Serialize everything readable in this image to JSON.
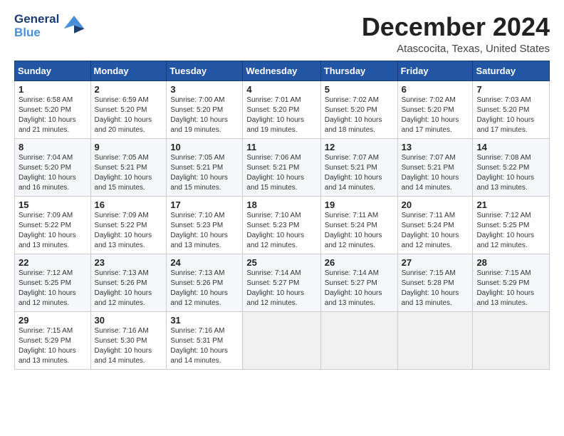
{
  "logo": {
    "line1": "General",
    "line2": "Blue"
  },
  "header": {
    "month": "December 2024",
    "location": "Atascocita, Texas, United States"
  },
  "days_of_week": [
    "Sunday",
    "Monday",
    "Tuesday",
    "Wednesday",
    "Thursday",
    "Friday",
    "Saturday"
  ],
  "weeks": [
    [
      {
        "day": 1,
        "sunrise": "6:58 AM",
        "sunset": "5:20 PM",
        "daylight": "10 hours and 21 minutes."
      },
      {
        "day": 2,
        "sunrise": "6:59 AM",
        "sunset": "5:20 PM",
        "daylight": "10 hours and 20 minutes."
      },
      {
        "day": 3,
        "sunrise": "7:00 AM",
        "sunset": "5:20 PM",
        "daylight": "10 hours and 19 minutes."
      },
      {
        "day": 4,
        "sunrise": "7:01 AM",
        "sunset": "5:20 PM",
        "daylight": "10 hours and 19 minutes."
      },
      {
        "day": 5,
        "sunrise": "7:02 AM",
        "sunset": "5:20 PM",
        "daylight": "10 hours and 18 minutes."
      },
      {
        "day": 6,
        "sunrise": "7:02 AM",
        "sunset": "5:20 PM",
        "daylight": "10 hours and 17 minutes."
      },
      {
        "day": 7,
        "sunrise": "7:03 AM",
        "sunset": "5:20 PM",
        "daylight": "10 hours and 17 minutes."
      }
    ],
    [
      {
        "day": 8,
        "sunrise": "7:04 AM",
        "sunset": "5:20 PM",
        "daylight": "10 hours and 16 minutes."
      },
      {
        "day": 9,
        "sunrise": "7:05 AM",
        "sunset": "5:21 PM",
        "daylight": "10 hours and 15 minutes."
      },
      {
        "day": 10,
        "sunrise": "7:05 AM",
        "sunset": "5:21 PM",
        "daylight": "10 hours and 15 minutes."
      },
      {
        "day": 11,
        "sunrise": "7:06 AM",
        "sunset": "5:21 PM",
        "daylight": "10 hours and 15 minutes."
      },
      {
        "day": 12,
        "sunrise": "7:07 AM",
        "sunset": "5:21 PM",
        "daylight": "10 hours and 14 minutes."
      },
      {
        "day": 13,
        "sunrise": "7:07 AM",
        "sunset": "5:21 PM",
        "daylight": "10 hours and 14 minutes."
      },
      {
        "day": 14,
        "sunrise": "7:08 AM",
        "sunset": "5:22 PM",
        "daylight": "10 hours and 13 minutes."
      }
    ],
    [
      {
        "day": 15,
        "sunrise": "7:09 AM",
        "sunset": "5:22 PM",
        "daylight": "10 hours and 13 minutes."
      },
      {
        "day": 16,
        "sunrise": "7:09 AM",
        "sunset": "5:22 PM",
        "daylight": "10 hours and 13 minutes."
      },
      {
        "day": 17,
        "sunrise": "7:10 AM",
        "sunset": "5:23 PM",
        "daylight": "10 hours and 13 minutes."
      },
      {
        "day": 18,
        "sunrise": "7:10 AM",
        "sunset": "5:23 PM",
        "daylight": "10 hours and 12 minutes."
      },
      {
        "day": 19,
        "sunrise": "7:11 AM",
        "sunset": "5:24 PM",
        "daylight": "10 hours and 12 minutes."
      },
      {
        "day": 20,
        "sunrise": "7:11 AM",
        "sunset": "5:24 PM",
        "daylight": "10 hours and 12 minutes."
      },
      {
        "day": 21,
        "sunrise": "7:12 AM",
        "sunset": "5:25 PM",
        "daylight": "10 hours and 12 minutes."
      }
    ],
    [
      {
        "day": 22,
        "sunrise": "7:12 AM",
        "sunset": "5:25 PM",
        "daylight": "10 hours and 12 minutes."
      },
      {
        "day": 23,
        "sunrise": "7:13 AM",
        "sunset": "5:26 PM",
        "daylight": "10 hours and 12 minutes."
      },
      {
        "day": 24,
        "sunrise": "7:13 AM",
        "sunset": "5:26 PM",
        "daylight": "10 hours and 12 minutes."
      },
      {
        "day": 25,
        "sunrise": "7:14 AM",
        "sunset": "5:27 PM",
        "daylight": "10 hours and 12 minutes."
      },
      {
        "day": 26,
        "sunrise": "7:14 AM",
        "sunset": "5:27 PM",
        "daylight": "10 hours and 13 minutes."
      },
      {
        "day": 27,
        "sunrise": "7:15 AM",
        "sunset": "5:28 PM",
        "daylight": "10 hours and 13 minutes."
      },
      {
        "day": 28,
        "sunrise": "7:15 AM",
        "sunset": "5:29 PM",
        "daylight": "10 hours and 13 minutes."
      }
    ],
    [
      {
        "day": 29,
        "sunrise": "7:15 AM",
        "sunset": "5:29 PM",
        "daylight": "10 hours and 13 minutes."
      },
      {
        "day": 30,
        "sunrise": "7:16 AM",
        "sunset": "5:30 PM",
        "daylight": "10 hours and 14 minutes."
      },
      {
        "day": 31,
        "sunrise": "7:16 AM",
        "sunset": "5:31 PM",
        "daylight": "10 hours and 14 minutes."
      },
      null,
      null,
      null,
      null
    ]
  ]
}
